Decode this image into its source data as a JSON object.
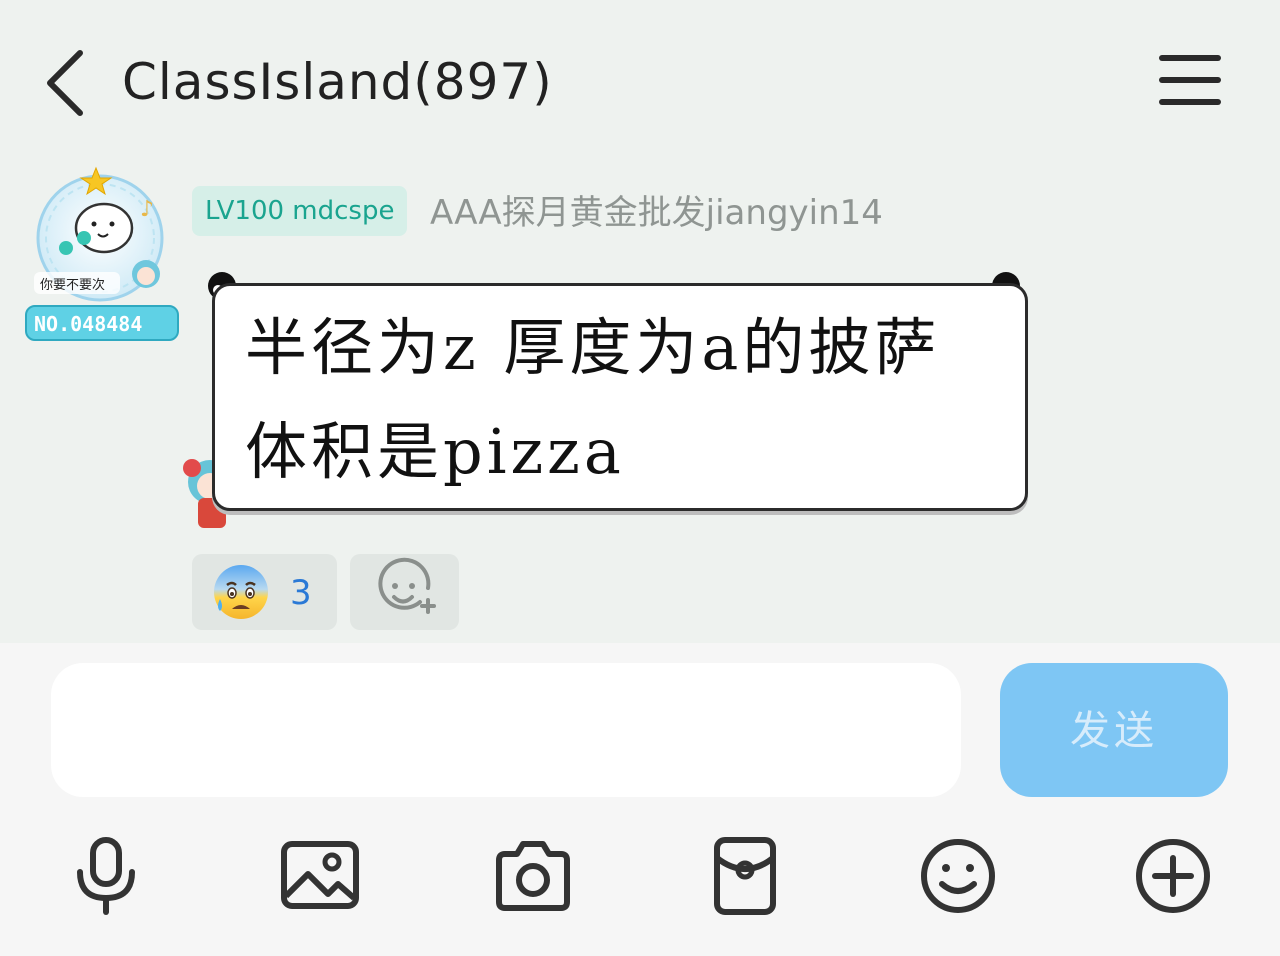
{
  "header": {
    "title": "ClassIsland(897)",
    "back_icon": "chevron-left-icon",
    "menu_icon": "hamburger-menu-icon"
  },
  "message": {
    "avatar_caption": "你要不要次",
    "avatar_number": "NO.048484",
    "level_badge": "LV100 mdcspe",
    "sender_name": "AAA探月黄金批发jiangyin14",
    "text": "半径为z 厚度为a的披萨 体积是pizza",
    "reaction": {
      "emoji": "anxious-face-with-sweat-emoji",
      "count": "3"
    },
    "add_reaction_icon": "add-reaction-icon"
  },
  "composer": {
    "input_value": "",
    "send_label": "发送"
  },
  "toolbar": [
    {
      "name": "microphone-icon"
    },
    {
      "name": "image-icon"
    },
    {
      "name": "camera-icon"
    },
    {
      "name": "red-packet-icon"
    },
    {
      "name": "emoji-icon"
    },
    {
      "name": "plus-icon"
    }
  ],
  "colors": {
    "background": "#eef2ef",
    "badge_bg": "#d6efe8",
    "badge_text": "#1aa48f",
    "send_button": "#7ec6f4",
    "reaction_count": "#2a79d6"
  }
}
